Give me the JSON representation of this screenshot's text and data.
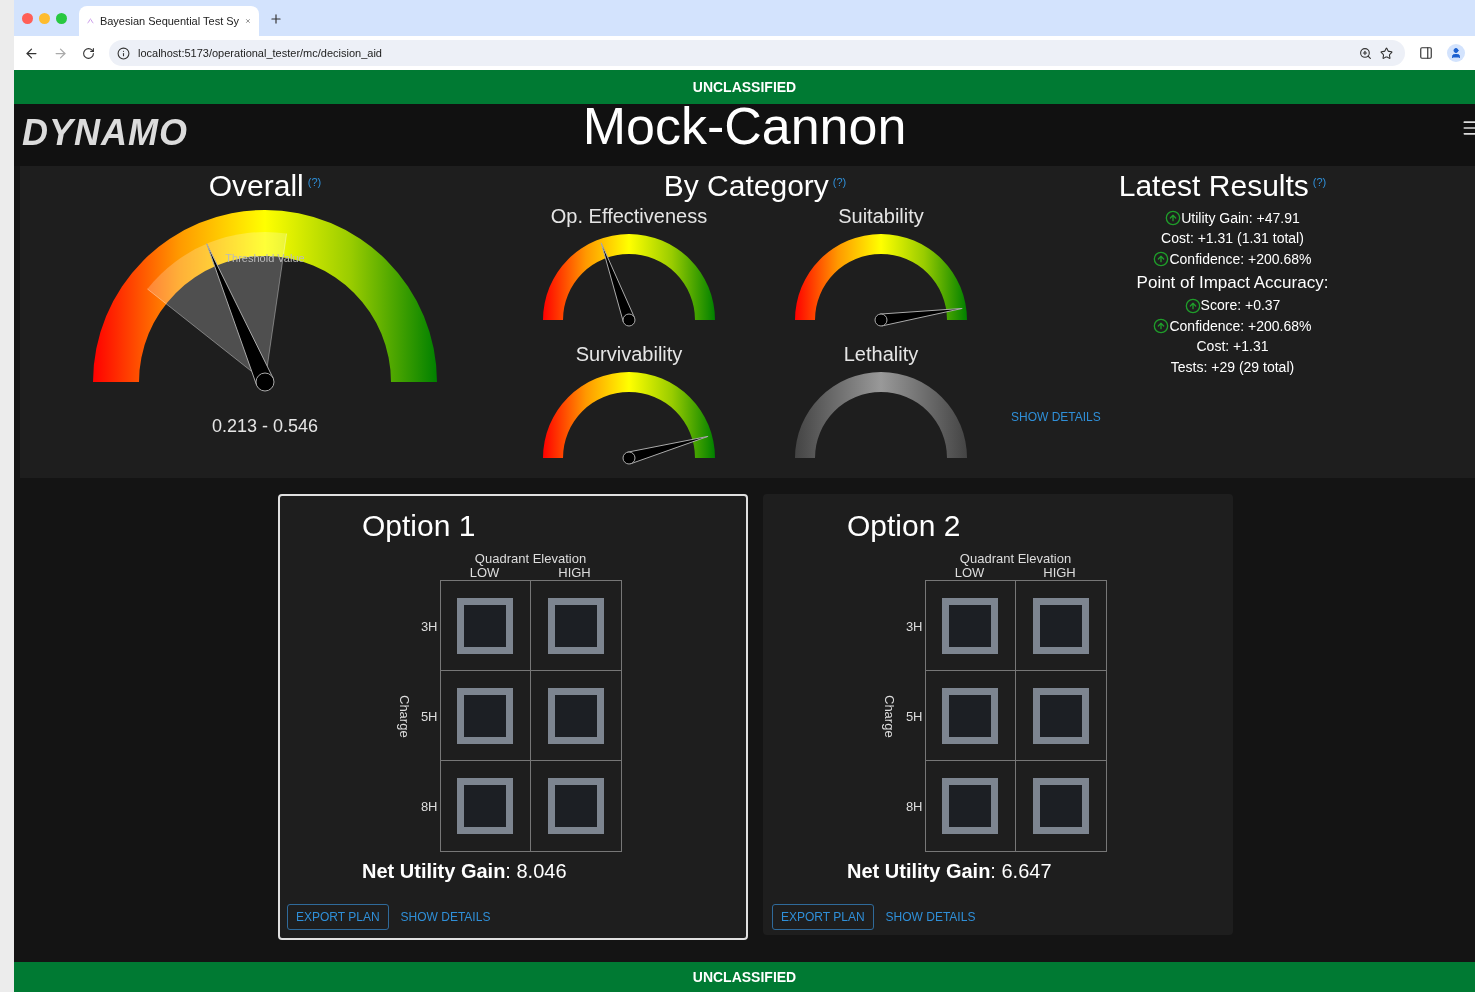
{
  "browser": {
    "tab_title": "Bayesian Sequential Test Sy",
    "url": "localhost:5173/operational_tester/mc/decision_aid"
  },
  "banner_top": "UNCLASSIFIED",
  "header": {
    "logo": "DYNAMO",
    "title": "Mock-Cannon"
  },
  "overall": {
    "title": "Overall",
    "help": "(?)",
    "level": 0.373,
    "threshold": {
      "label": "Threshold Value",
      "low": {
        "level": 0.213
      },
      "high": {
        "level": 0.546
      }
    },
    "range": "0.213 - 0.546"
  },
  "by_category": {
    "title": "By Category",
    "help": "(?)",
    "gauges": [
      {
        "name": "Op. Effectiveness",
        "active": true,
        "level": 0.39
      },
      {
        "name": "Suitability",
        "active": true,
        "level": 0.955
      },
      {
        "name": "Survivability",
        "active": true,
        "level": 0.915
      },
      {
        "name": "Lethality",
        "active": false
      }
    ]
  },
  "latest_results": {
    "title": "Latest Results",
    "help": "(?)",
    "lines": [
      {
        "kind": "stat",
        "text": "Utility Gain: +47.91",
        "trend_up": true
      },
      {
        "kind": "stat",
        "text": "Cost: +1.31 (1.31 total)",
        "trend_up": false
      },
      {
        "kind": "stat",
        "text": "Confidence: +200.68%",
        "trend_up": true
      },
      {
        "kind": "heading",
        "text": "Point of Impact Accuracy:"
      },
      {
        "kind": "stat",
        "text": "Score: +0.37",
        "trend_up": true
      },
      {
        "kind": "stat",
        "text": "Confidence: +200.68%",
        "trend_up": true
      },
      {
        "kind": "stat",
        "text": "Cost: +1.31",
        "trend_up": false
      },
      {
        "kind": "stat",
        "text": "Tests: +29 (29 total)",
        "trend_up": false
      }
    ],
    "show_details": "SHOW DETAILS"
  },
  "options": [
    {
      "title": "Option 1",
      "selected": true,
      "grid": {
        "column_title": "Quadrant Elevation",
        "columns": [
          "LOW",
          "HIGH"
        ],
        "row_title": "Charge",
        "rows": [
          "3H",
          "5H",
          "8H"
        ]
      },
      "net_utility": "**Net Utility Gain**: 8.046",
      "export": "EXPORT PLAN",
      "details": "SHOW DETAILS"
    },
    {
      "title": "Option 2",
      "selected": false,
      "grid": {
        "column_title": "Quadrant Elevation",
        "columns": [
          "LOW",
          "HIGH"
        ],
        "row_title": "Charge",
        "rows": [
          "3H",
          "5H",
          "8H"
        ]
      },
      "net_utility": "**Net Utility Gain**: 6.647",
      "export": "EXPORT PLAN",
      "details": "SHOW DETAILS"
    }
  ],
  "banner_bottom": "UNCLASSIFIED"
}
